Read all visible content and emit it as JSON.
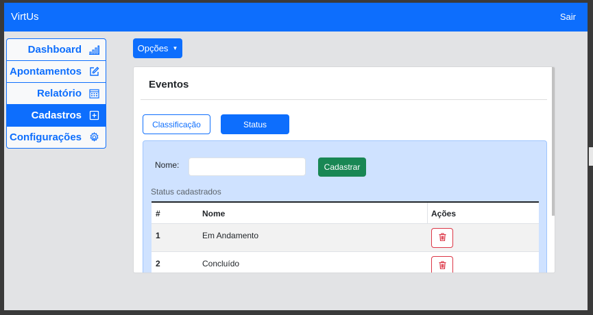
{
  "app": {
    "brand": "VirtUs",
    "logout_label": "Sair"
  },
  "sidebar": {
    "items": [
      {
        "label": "Dashboard",
        "icon": "bar-chart-icon",
        "active": false
      },
      {
        "label": "Apontamentos",
        "icon": "edit-icon",
        "active": false
      },
      {
        "label": "Relatório",
        "icon": "calendar-icon",
        "active": false
      },
      {
        "label": "Cadastros",
        "icon": "plus-square-icon",
        "active": true
      },
      {
        "label": "Configurações",
        "icon": "gear-icon",
        "active": false
      }
    ]
  },
  "toolbar": {
    "options_label": "Opções"
  },
  "card": {
    "title": "Eventos",
    "tabs": [
      {
        "label": "Classificação",
        "active": false
      },
      {
        "label": "Status",
        "active": true
      }
    ]
  },
  "form": {
    "name_label": "Nome:",
    "name_value": "",
    "submit_label": "Cadastrar"
  },
  "table": {
    "caption": "Status cadastrados",
    "headers": [
      "#",
      "Nome",
      "Ações"
    ],
    "rows": [
      {
        "id": "1",
        "name": "Em Andamento"
      },
      {
        "id": "2",
        "name": "Concluído"
      }
    ]
  },
  "colors": {
    "primary": "#0d6efd",
    "success": "#198754",
    "danger": "#dc3545",
    "panel": "#cfe2ff"
  }
}
